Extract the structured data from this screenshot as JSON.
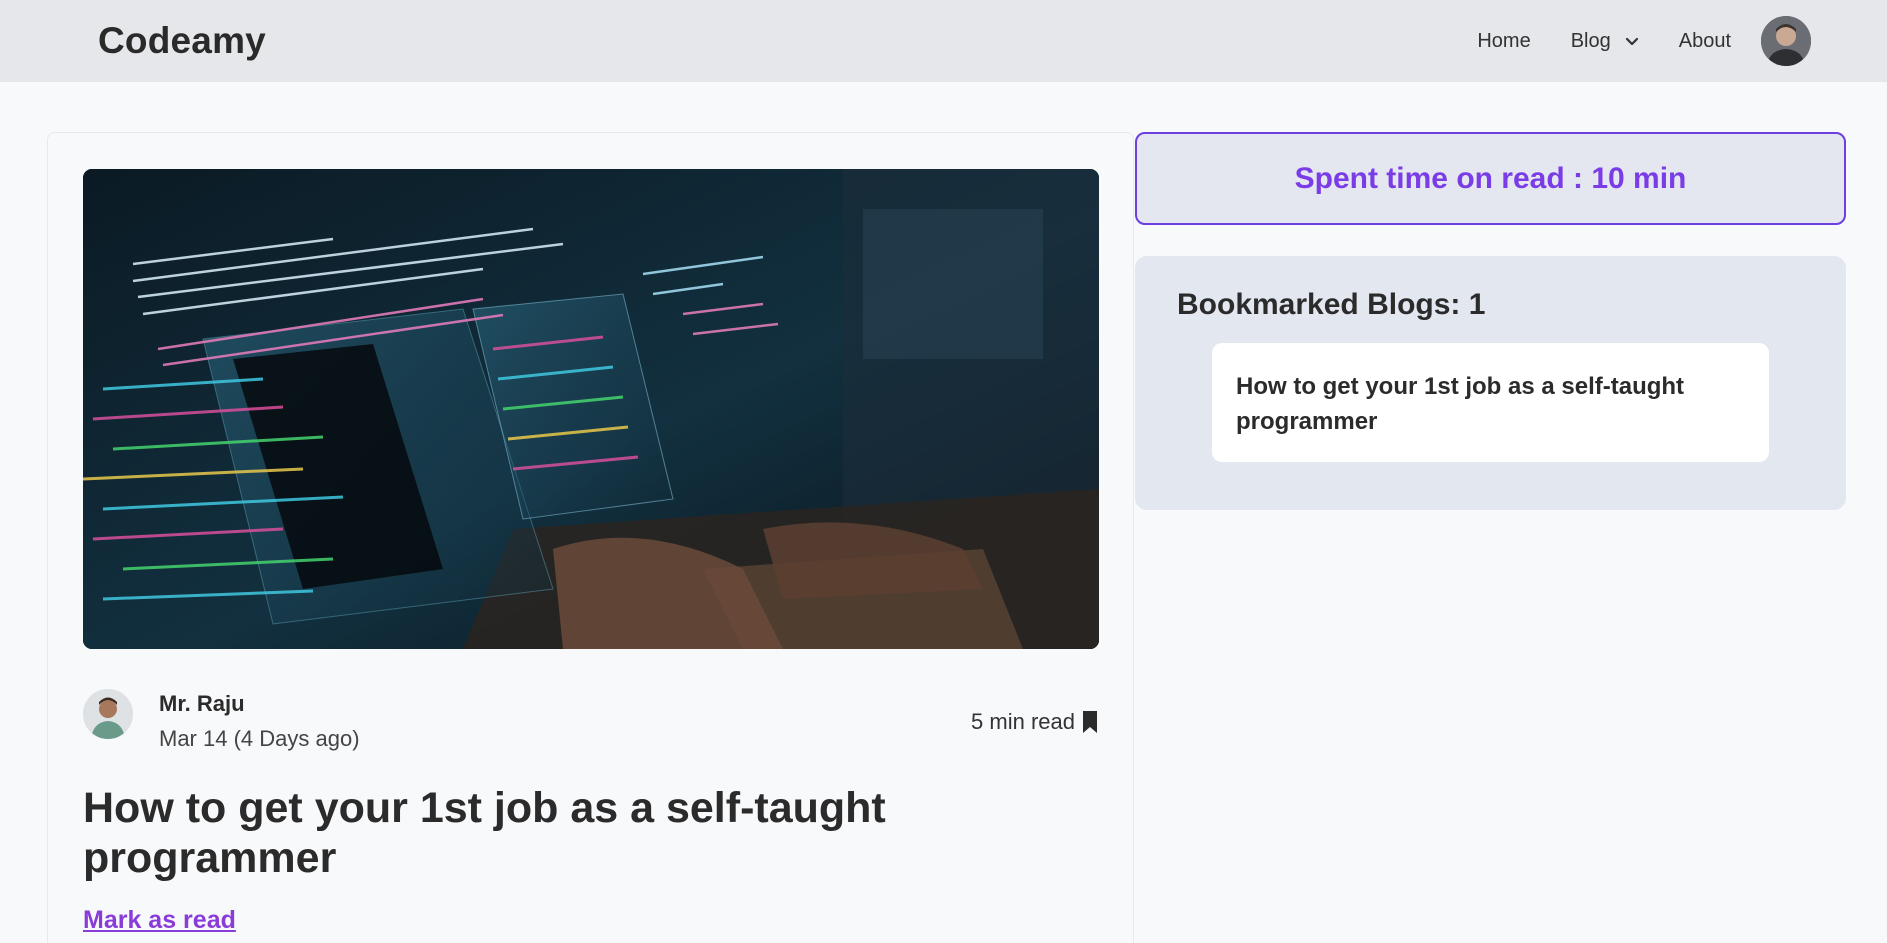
{
  "navbar": {
    "brand": "Codeamy",
    "links": {
      "home": "Home",
      "blog": "Blog",
      "about": "About"
    }
  },
  "post": {
    "author": "Mr. Raju",
    "date": "Mar 14 (4 Days ago)",
    "read_time": "5 min read",
    "title": "How to get your 1st job as a self-taught programmer",
    "mark_as_read": "Mark as read"
  },
  "sidebar": {
    "spent_time": "Spent time on read : 10 min",
    "bookmarked_title": "Bookmarked Blogs: 1",
    "bookmarked_items": [
      "How to get your 1st job as a self-taught programmer"
    ]
  },
  "colors": {
    "accent": "#7a3ce6",
    "link": "#8a3cd8",
    "navbar_bg": "#e6e7ea",
    "sidebar_panel_bg": "#e3e7ef"
  }
}
